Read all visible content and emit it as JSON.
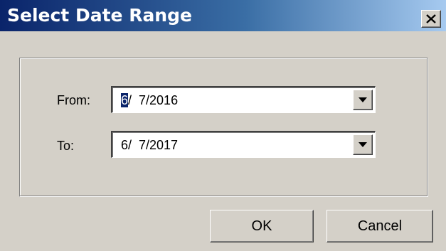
{
  "dialog": {
    "title": "Select Date Range",
    "close_icon": "close-x-icon"
  },
  "fields": {
    "from": {
      "label": "From:",
      "value_selected": "6",
      "value_rest": "/  7/2016",
      "dropdown_icon": "dropdown-arrow-icon"
    },
    "to": {
      "label": "To:",
      "value": "6/  7/2017",
      "dropdown_icon": "dropdown-arrow-icon"
    }
  },
  "buttons": {
    "ok_label": "OK",
    "cancel_label": "Cancel"
  },
  "colors": {
    "dialog_face": "#d4d0c8",
    "title_start": "#0a246a",
    "title_end": "#a6caf0",
    "selection": "#0a246a"
  }
}
